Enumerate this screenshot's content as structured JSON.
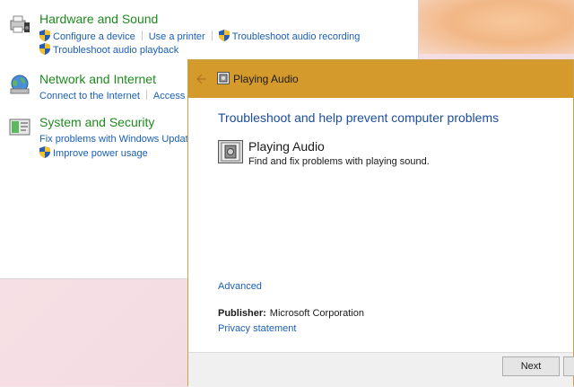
{
  "control_panel": {
    "categories": [
      {
        "title": "Hardware and Sound",
        "icon": "printer-speaker-icon",
        "links_row1": [
          "Configure a device",
          "Use a printer",
          "Troubleshoot audio recording"
        ],
        "links_row2": [
          "Troubleshoot audio playback"
        ]
      },
      {
        "title": "Network and Internet",
        "icon": "network-globe-icon",
        "links_row1": [
          "Connect to the Internet",
          "Access sh"
        ]
      },
      {
        "title": "System and Security",
        "icon": "system-security-icon",
        "links_row1": [
          "Fix problems with Windows Update"
        ],
        "links_row2": [
          "Improve power usage"
        ]
      }
    ]
  },
  "troubleshooter": {
    "window_title": "Playing Audio",
    "heading": "Troubleshoot and help prevent computer problems",
    "item_title": "Playing Audio",
    "item_description": "Find and fix problems with playing sound.",
    "advanced_link": "Advanced",
    "publisher_label": "Publisher:",
    "publisher_value": "Microsoft Corporation",
    "privacy_link": "Privacy statement",
    "next_button": "Next"
  },
  "colors": {
    "category_title": "#1e8a1e",
    "link": "#1a5fb4",
    "titlebar": "#d59a2c",
    "heading": "#1c4da1"
  }
}
